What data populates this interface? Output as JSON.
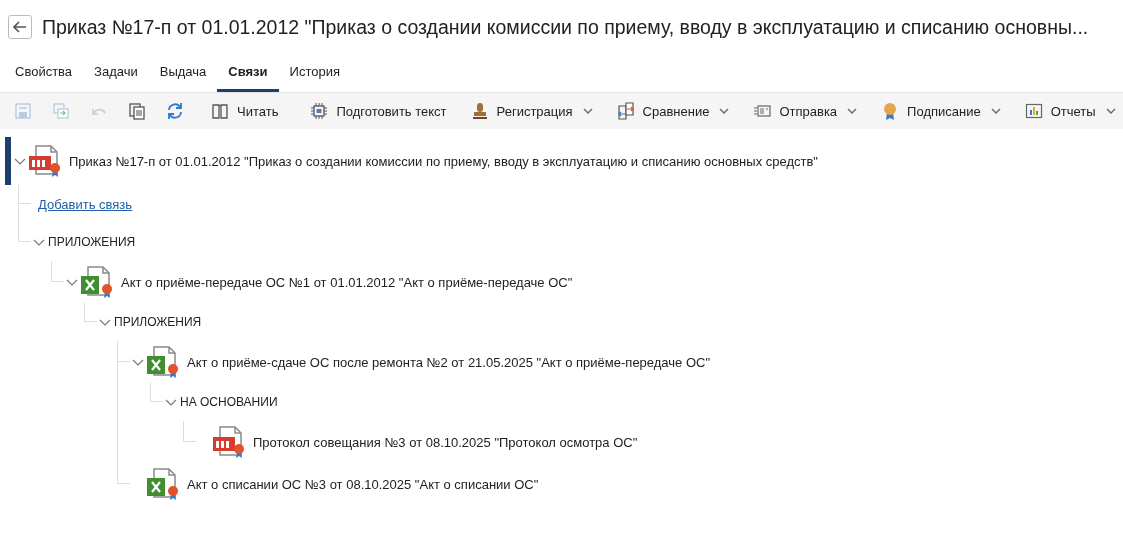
{
  "header": {
    "title": "Приказ №17-п от 01.01.2012 \"Приказ о создании комиссии по приему, вводу в эксплуатацию и списанию основны..."
  },
  "tabs": [
    {
      "label": "Свойства",
      "selected": false
    },
    {
      "label": "Задачи",
      "selected": false
    },
    {
      "label": "Выдача",
      "selected": false
    },
    {
      "label": "Связи",
      "selected": true
    },
    {
      "label": "История",
      "selected": false
    }
  ],
  "toolbar": [
    {
      "kind": "save",
      "disabled": true
    },
    {
      "kind": "save-as",
      "disabled": true
    },
    {
      "kind": "undo",
      "disabled": true
    },
    {
      "kind": "copy",
      "disabled": false
    },
    {
      "kind": "refresh",
      "disabled": false
    },
    {
      "kind": "separator"
    },
    {
      "kind": "read",
      "label": "Читать"
    },
    {
      "kind": "separator"
    },
    {
      "kind": "prepare",
      "label": "Подготовить текст"
    },
    {
      "kind": "register",
      "label": "Регистрация",
      "dropdown": true
    },
    {
      "kind": "compare",
      "label": "Сравнение",
      "dropdown": true
    },
    {
      "kind": "send",
      "label": "Отправка",
      "dropdown": true
    },
    {
      "kind": "sign",
      "label": "Подписание",
      "dropdown": true
    },
    {
      "kind": "reports",
      "label": "Отчеты",
      "dropdown": true
    }
  ],
  "tree": [
    {
      "kind": "pdf",
      "selected": true,
      "expanded": true,
      "label": "Приказ №17-п от 01.01.2012 \"Приказ о создании комиссии по приему, вводу в эксплуатацию и списанию основных средств\"",
      "children": [
        {
          "kind": "link",
          "label": "Добавить связь"
        },
        {
          "kind": "group",
          "expanded": true,
          "label": "ПРИЛОЖЕНИЯ",
          "children": [
            {
              "kind": "spreadsheet",
              "selected": false,
              "expanded": true,
              "label": "Акт о приёме-передаче ОС №1 от 01.01.2012 \"Акт о приёме-передаче ОС\"",
              "children": [
                {
                  "kind": "group",
                  "expanded": true,
                  "label": "ПРИЛОЖЕНИЯ",
                  "children": [
                    {
                      "kind": "spreadsheet",
                      "selected": false,
                      "expanded": true,
                      "label": "Акт о приёме-сдаче ОС после ремонта №2 от 21.05.2025 \"Акт о приёме-передаче ОС\"",
                      "children": [
                        {
                          "kind": "group",
                          "expanded": true,
                          "label": "НА ОСНОВАНИИ",
                          "children": [
                            {
                              "kind": "pdf",
                              "selected": false,
                              "label": "Протокол совещания №3 от 08.10.2025 \"Протокол осмотра ОС\""
                            }
                          ]
                        }
                      ]
                    },
                    {
                      "kind": "spreadsheet",
                      "selected": false,
                      "label": "Акт о списании ОС №3 от 08.10.2025 \"Акт о списании ОС\""
                    }
                  ]
                }
              ]
            }
          ]
        }
      ]
    }
  ]
}
